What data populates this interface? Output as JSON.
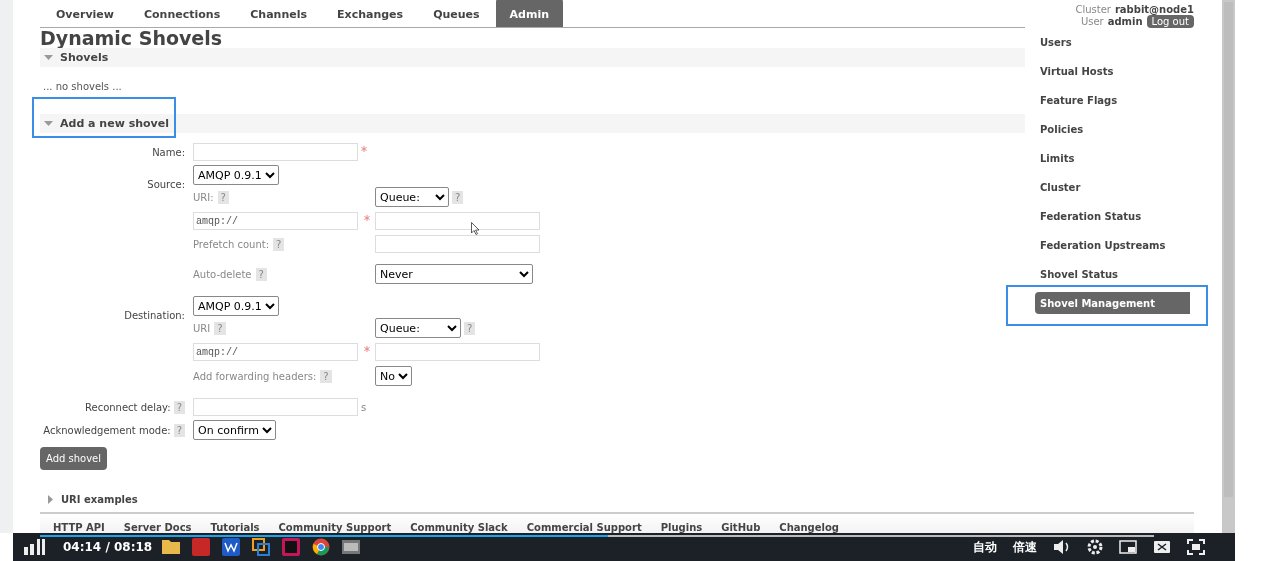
{
  "nav": {
    "tabs": [
      {
        "label": "Overview",
        "selected": false
      },
      {
        "label": "Connections",
        "selected": false
      },
      {
        "label": "Channels",
        "selected": false
      },
      {
        "label": "Exchanges",
        "selected": false
      },
      {
        "label": "Queues",
        "selected": false
      },
      {
        "label": "Admin",
        "selected": true
      }
    ],
    "cluster_label": "Cluster",
    "cluster": "rabbit@node1",
    "user_label": "User",
    "user": "admin",
    "logout": "Log out"
  },
  "page_title": "Dynamic Shovels",
  "shovels_section": {
    "title": "Shovels",
    "expanded": true,
    "empty_text": "... no shovels ..."
  },
  "add_section": {
    "title": "Add a new shovel",
    "expanded": true,
    "highlighted": true
  },
  "form": {
    "name": {
      "label": "Name:",
      "required": true
    },
    "source": {
      "label": "Source:",
      "protocol": "AMQP 0.9.1",
      "uri_label": "URI:",
      "uri_help": "?",
      "uri": "amqp://",
      "uri_required": true,
      "target_type": "Queue:",
      "target_help": "?",
      "prefetch_label": "Prefetch count:",
      "prefetch_help": "?",
      "auto_delete_label": "Auto-delete",
      "auto_delete_help": "?",
      "auto_delete": "Never"
    },
    "destination": {
      "label": "Destination:",
      "protocol": "AMQP 0.9.1",
      "uri_label": "URI",
      "uri_help": "?",
      "uri": "amqp://",
      "uri_required": true,
      "target_type": "Queue:",
      "target_help": "?",
      "headers_label": "Add forwarding headers:",
      "headers_help": "?",
      "headers": "No"
    },
    "reconnect": {
      "label": "Reconnect delay:",
      "help": "?",
      "unit": "s"
    },
    "ack": {
      "label": "Acknowledgement mode:",
      "help": "?",
      "value": "On confirm"
    },
    "submit": "Add shovel"
  },
  "uri_examples": {
    "title": "URI examples",
    "expanded": false
  },
  "sidebar": {
    "items": [
      {
        "label": "Users",
        "selected": false,
        "highlighted": false
      },
      {
        "label": "Virtual Hosts",
        "selected": false,
        "highlighted": false
      },
      {
        "label": "Feature Flags",
        "selected": false,
        "highlighted": false
      },
      {
        "label": "Policies",
        "selected": false,
        "highlighted": false
      },
      {
        "label": "Limits",
        "selected": false,
        "highlighted": false
      },
      {
        "label": "Cluster",
        "selected": false,
        "highlighted": false
      },
      {
        "label": "Federation Status",
        "selected": false,
        "highlighted": false
      },
      {
        "label": "Federation Upstreams",
        "selected": false,
        "highlighted": false
      },
      {
        "label": "Shovel Status",
        "selected": false,
        "highlighted": false
      },
      {
        "label": "Shovel Management",
        "selected": true,
        "highlighted": true
      }
    ]
  },
  "footer": {
    "links": [
      "HTTP API",
      "Server Docs",
      "Tutorials",
      "Community Support",
      "Community Slack",
      "Commercial Support",
      "Plugins",
      "GitHub",
      "Changelog"
    ]
  },
  "player": {
    "progress": {
      "level": 0.51
    },
    "time": "04:14 / 08:18",
    "quality": "自动",
    "speed": "倍速"
  }
}
